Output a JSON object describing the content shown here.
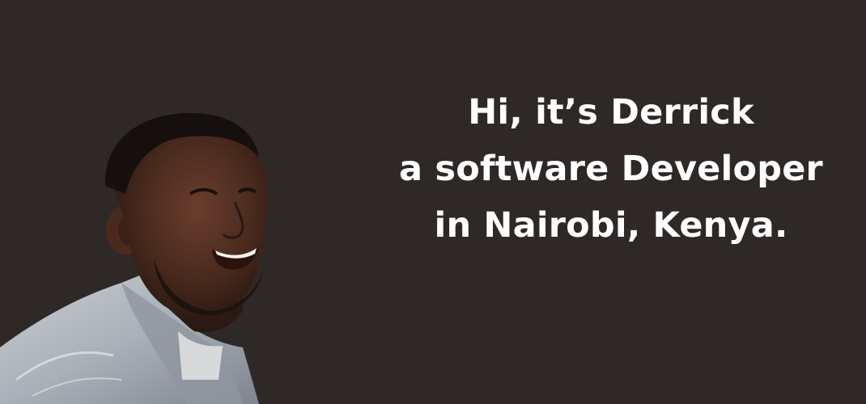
{
  "headline": {
    "line1": "Hi, it’s Derrick",
    "line2": "a software Developer",
    "line3": "in Nairobi, Kenya."
  },
  "colors": {
    "background": "#2e2927",
    "text": "#ffffff"
  },
  "image": {
    "subject": "portrait-photo"
  }
}
